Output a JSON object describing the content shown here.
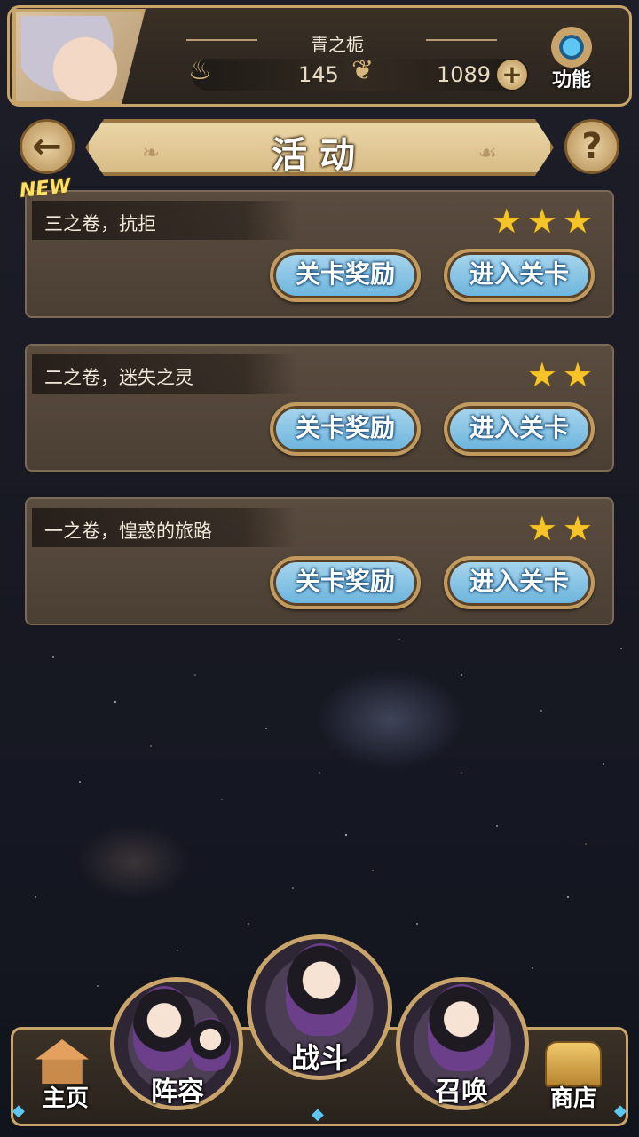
{
  "header": {
    "player_name": "青之栀",
    "currency_a": "145",
    "currency_b": "1089",
    "plus_symbol": "+",
    "function_label": "功能"
  },
  "title_row": {
    "back_symbol": "←",
    "title": "活动",
    "help_symbol": "?"
  },
  "stages": [
    {
      "title": "三之卷，抗拒",
      "stars": 3,
      "is_new": true,
      "new_label": "NEW",
      "reward_label": "关卡奖励",
      "enter_label": "进入关卡"
    },
    {
      "title": "二之卷，迷失之灵",
      "stars": 2,
      "reward_label": "关卡奖励",
      "enter_label": "进入关卡"
    },
    {
      "title": "一之卷，惶惑的旅路",
      "stars": 2,
      "reward_label": "关卡奖励",
      "enter_label": "进入关卡"
    }
  ],
  "bottom_nav": {
    "home": "主页",
    "lineup": "阵容",
    "battle": "战斗",
    "summon": "召唤",
    "shop": "商店"
  },
  "colors": {
    "accent_gold": "#c9a46a",
    "button_blue": "#6ab3dc",
    "star_yellow": "#f6c429",
    "background": "#191a23"
  }
}
